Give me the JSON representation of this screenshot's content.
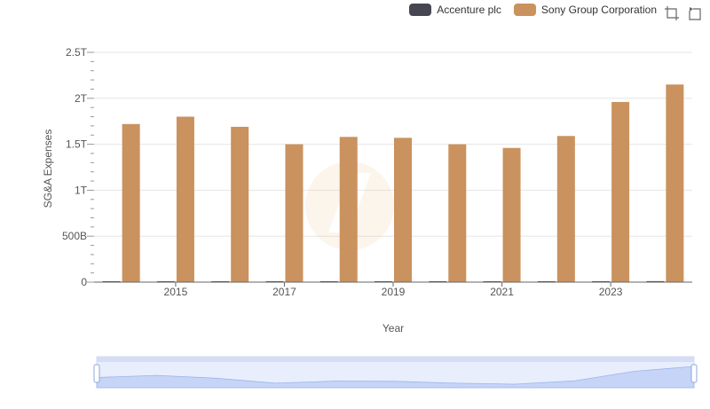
{
  "legend": [
    {
      "name": "Accenture plc",
      "color": "#464653"
    },
    {
      "name": "Sony Group Corporation",
      "color": "#c9925e"
    }
  ],
  "toolbar": {
    "icons": [
      "zoom-icon",
      "restore-icon"
    ]
  },
  "chart_data": {
    "type": "bar",
    "xlabel": "Year",
    "ylabel": "SG&A Expenses",
    "ylim": [
      0,
      2500000000000
    ],
    "y_ticks": [
      "0",
      "500B",
      "1T",
      "1.5T",
      "2T",
      "2.5T"
    ],
    "x_tick_labels": [
      "2015",
      "2017",
      "2019",
      "2021",
      "2023"
    ],
    "categories": [
      "2014",
      "2015",
      "2016",
      "2017",
      "2018",
      "2019",
      "2020",
      "2021",
      "2022",
      "2023",
      "2024"
    ],
    "series": [
      {
        "name": "Accenture plc",
        "color": "#464653",
        "values": [
          3500000000,
          3900000000,
          4300000000,
          5000000000,
          5900000000,
          6600000000,
          6500000000,
          7300000000,
          9000000000,
          10300000000,
          10700000000
        ]
      },
      {
        "name": "Sony Group Corporation",
        "color": "#c9925e",
        "values": [
          1720000000000,
          1800000000000,
          1690000000000,
          1500000000000,
          1580000000000,
          1570000000000,
          1500000000000,
          1460000000000,
          1590000000000,
          1960000000000,
          2150000000000
        ]
      }
    ],
    "grid": true,
    "legend_position": "top-right",
    "data_zoom": {
      "visible": true,
      "range": [
        0,
        100
      ]
    }
  }
}
